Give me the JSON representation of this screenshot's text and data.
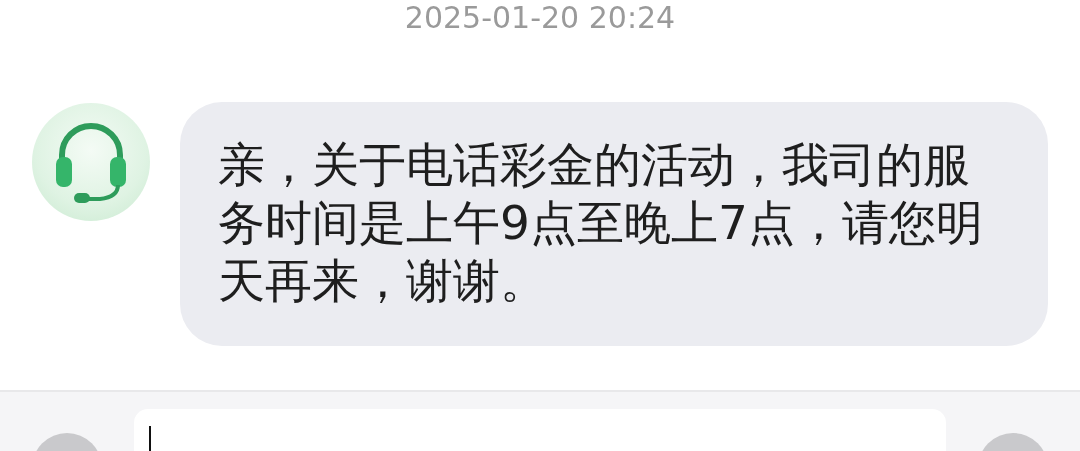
{
  "timestamp": "2025-01-20 20:24",
  "messages": [
    {
      "kind": "agent",
      "text": "亲，关于电话彩金的活动，我司的服务时间是上午9点至晚上7点，请您明天再来，谢谢。"
    }
  ]
}
